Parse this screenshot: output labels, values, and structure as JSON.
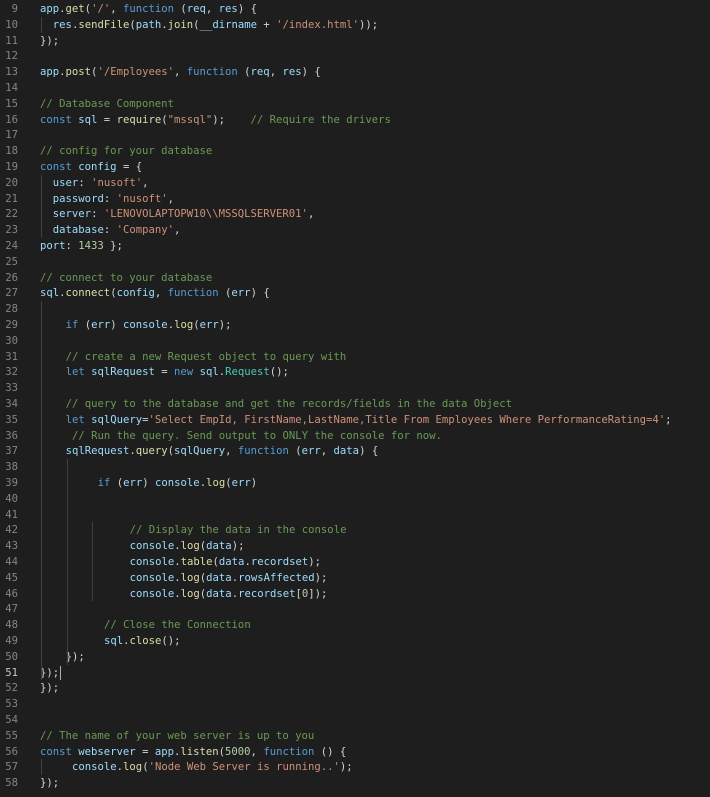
{
  "editor": {
    "active_line": 51,
    "lines": [
      {
        "n": 9,
        "indent": 0,
        "tokens": [
          [
            "v",
            "app"
          ],
          [
            "p",
            "."
          ],
          [
            "f",
            "get"
          ],
          [
            "p",
            "("
          ],
          [
            "s",
            "'/'"
          ],
          [
            "p",
            ", "
          ],
          [
            "k",
            "function"
          ],
          [
            "p",
            " ("
          ],
          [
            "v",
            "req"
          ],
          [
            "p",
            ", "
          ],
          [
            "v",
            "res"
          ],
          [
            "p",
            ") {"
          ]
        ]
      },
      {
        "n": 10,
        "indent": 2,
        "tokens": [
          [
            "v",
            "res"
          ],
          [
            "p",
            "."
          ],
          [
            "f",
            "sendFile"
          ],
          [
            "p",
            "("
          ],
          [
            "v",
            "path"
          ],
          [
            "p",
            "."
          ],
          [
            "f",
            "join"
          ],
          [
            "p",
            "("
          ],
          [
            "v",
            "__dirname"
          ],
          [
            "p",
            " + "
          ],
          [
            "s",
            "'/index.html'"
          ],
          [
            "p",
            "));"
          ]
        ]
      },
      {
        "n": 11,
        "indent": 0,
        "tokens": [
          [
            "p",
            "});"
          ]
        ]
      },
      {
        "n": 12,
        "indent": 0,
        "tokens": []
      },
      {
        "n": 13,
        "indent": 0,
        "tokens": [
          [
            "v",
            "app"
          ],
          [
            "p",
            "."
          ],
          [
            "f",
            "post"
          ],
          [
            "p",
            "("
          ],
          [
            "s",
            "'/Employees'"
          ],
          [
            "p",
            ", "
          ],
          [
            "k",
            "function"
          ],
          [
            "p",
            " ("
          ],
          [
            "v",
            "req"
          ],
          [
            "p",
            ", "
          ],
          [
            "v",
            "res"
          ],
          [
            "p",
            ") {"
          ]
        ]
      },
      {
        "n": 14,
        "indent": 0,
        "tokens": []
      },
      {
        "n": 15,
        "indent": 0,
        "tokens": [
          [
            "c",
            "// Database Component"
          ]
        ]
      },
      {
        "n": 16,
        "indent": 0,
        "tokens": [
          [
            "k",
            "const"
          ],
          [
            "p",
            " "
          ],
          [
            "v",
            "sql"
          ],
          [
            "p",
            " = "
          ],
          [
            "f",
            "require"
          ],
          [
            "p",
            "("
          ],
          [
            "s",
            "\"mssql\""
          ],
          [
            "p",
            ");    "
          ],
          [
            "c",
            "// Require the drivers"
          ]
        ]
      },
      {
        "n": 17,
        "indent": 0,
        "tokens": []
      },
      {
        "n": 18,
        "indent": 0,
        "tokens": [
          [
            "c",
            "// config for your database"
          ]
        ]
      },
      {
        "n": 19,
        "indent": 0,
        "tokens": [
          [
            "k",
            "const"
          ],
          [
            "p",
            " "
          ],
          [
            "v",
            "config"
          ],
          [
            "p",
            " = {"
          ]
        ]
      },
      {
        "n": 20,
        "indent": 2,
        "tokens": [
          [
            "v",
            "user"
          ],
          [
            "p",
            ": "
          ],
          [
            "s",
            "'nusoft'"
          ],
          [
            "p",
            ","
          ]
        ]
      },
      {
        "n": 21,
        "indent": 2,
        "tokens": [
          [
            "v",
            "password"
          ],
          [
            "p",
            ": "
          ],
          [
            "s",
            "'nusoft'"
          ],
          [
            "p",
            ","
          ]
        ]
      },
      {
        "n": 22,
        "indent": 2,
        "tokens": [
          [
            "v",
            "server"
          ],
          [
            "p",
            ": "
          ],
          [
            "s",
            "'LENOVOLAPTOPW10\\\\MSSQLSERVER01'"
          ],
          [
            "p",
            ","
          ]
        ]
      },
      {
        "n": 23,
        "indent": 2,
        "tokens": [
          [
            "v",
            "database"
          ],
          [
            "p",
            ": "
          ],
          [
            "s",
            "'Company'"
          ],
          [
            "p",
            ","
          ]
        ]
      },
      {
        "n": 24,
        "indent": 0,
        "tokens": [
          [
            "v",
            "port"
          ],
          [
            "p",
            ": "
          ],
          [
            "n",
            "1433"
          ],
          [
            "p",
            " };"
          ]
        ]
      },
      {
        "n": 25,
        "indent": 0,
        "tokens": []
      },
      {
        "n": 26,
        "indent": 0,
        "tokens": [
          [
            "c",
            "// connect to your database"
          ]
        ]
      },
      {
        "n": 27,
        "indent": 0,
        "tokens": [
          [
            "v",
            "sql"
          ],
          [
            "p",
            "."
          ],
          [
            "f",
            "connect"
          ],
          [
            "p",
            "("
          ],
          [
            "v",
            "config"
          ],
          [
            "p",
            ", "
          ],
          [
            "k",
            "function"
          ],
          [
            "p",
            " ("
          ],
          [
            "v",
            "err"
          ],
          [
            "p",
            ") {"
          ]
        ]
      },
      {
        "n": 28,
        "indent": 0,
        "tokens": []
      },
      {
        "n": 29,
        "indent": 4,
        "tokens": [
          [
            "k",
            "if"
          ],
          [
            "p",
            " ("
          ],
          [
            "v",
            "err"
          ],
          [
            "p",
            ") "
          ],
          [
            "v",
            "console"
          ],
          [
            "p",
            "."
          ],
          [
            "f",
            "log"
          ],
          [
            "p",
            "("
          ],
          [
            "v",
            "err"
          ],
          [
            "p",
            ");"
          ]
        ]
      },
      {
        "n": 30,
        "indent": 0,
        "tokens": []
      },
      {
        "n": 31,
        "indent": 4,
        "tokens": [
          [
            "c",
            "// create a new Request object to query with"
          ]
        ]
      },
      {
        "n": 32,
        "indent": 4,
        "tokens": [
          [
            "k",
            "let"
          ],
          [
            "p",
            " "
          ],
          [
            "v",
            "sqlRequest"
          ],
          [
            "p",
            " = "
          ],
          [
            "k",
            "new"
          ],
          [
            "p",
            " "
          ],
          [
            "v",
            "sql"
          ],
          [
            "p",
            "."
          ],
          [
            "t",
            "Request"
          ],
          [
            "p",
            "();"
          ]
        ]
      },
      {
        "n": 33,
        "indent": 0,
        "tokens": []
      },
      {
        "n": 34,
        "indent": 4,
        "tokens": [
          [
            "c",
            "// query to the database and get the records/fields in the data Object"
          ]
        ]
      },
      {
        "n": 35,
        "indent": 4,
        "tokens": [
          [
            "k",
            "let"
          ],
          [
            "p",
            " "
          ],
          [
            "v",
            "sqlQuery"
          ],
          [
            "p",
            "="
          ],
          [
            "s",
            "'Select EmpId, FirstName,LastName,Title From Employees Where PerformanceRating=4'"
          ],
          [
            "p",
            ";"
          ]
        ]
      },
      {
        "n": 36,
        "indent": 5,
        "tokens": [
          [
            "c",
            "// Run the query. Send output to ONLY the console for now."
          ]
        ]
      },
      {
        "n": 37,
        "indent": 4,
        "tokens": [
          [
            "v",
            "sqlRequest"
          ],
          [
            "p",
            "."
          ],
          [
            "f",
            "query"
          ],
          [
            "p",
            "("
          ],
          [
            "v",
            "sqlQuery"
          ],
          [
            "p",
            ", "
          ],
          [
            "k",
            "function"
          ],
          [
            "p",
            " ("
          ],
          [
            "v",
            "err"
          ],
          [
            "p",
            ", "
          ],
          [
            "v",
            "data"
          ],
          [
            "p",
            ") {"
          ]
        ]
      },
      {
        "n": 38,
        "indent": 0,
        "tokens": []
      },
      {
        "n": 39,
        "indent": 9,
        "tokens": [
          [
            "k",
            "if"
          ],
          [
            "p",
            " ("
          ],
          [
            "v",
            "err"
          ],
          [
            "p",
            ") "
          ],
          [
            "v",
            "console"
          ],
          [
            "p",
            "."
          ],
          [
            "f",
            "log"
          ],
          [
            "p",
            "("
          ],
          [
            "v",
            "err"
          ],
          [
            "p",
            ")"
          ]
        ]
      },
      {
        "n": 40,
        "indent": 0,
        "tokens": []
      },
      {
        "n": 41,
        "indent": 0,
        "tokens": []
      },
      {
        "n": 42,
        "indent": 14,
        "tokens": [
          [
            "c",
            "// Display the data in the console"
          ]
        ]
      },
      {
        "n": 43,
        "indent": 14,
        "tokens": [
          [
            "v",
            "console"
          ],
          [
            "p",
            "."
          ],
          [
            "f",
            "log"
          ],
          [
            "p",
            "("
          ],
          [
            "v",
            "data"
          ],
          [
            "p",
            ");"
          ]
        ]
      },
      {
        "n": 44,
        "indent": 14,
        "tokens": [
          [
            "v",
            "console"
          ],
          [
            "p",
            "."
          ],
          [
            "f",
            "table"
          ],
          [
            "p",
            "("
          ],
          [
            "v",
            "data"
          ],
          [
            "p",
            "."
          ],
          [
            "v",
            "recordset"
          ],
          [
            "p",
            ");"
          ]
        ]
      },
      {
        "n": 45,
        "indent": 14,
        "tokens": [
          [
            "v",
            "console"
          ],
          [
            "p",
            "."
          ],
          [
            "f",
            "log"
          ],
          [
            "p",
            "("
          ],
          [
            "v",
            "data"
          ],
          [
            "p",
            "."
          ],
          [
            "v",
            "rowsAffected"
          ],
          [
            "p",
            ");"
          ]
        ]
      },
      {
        "n": 46,
        "indent": 14,
        "tokens": [
          [
            "v",
            "console"
          ],
          [
            "p",
            "."
          ],
          [
            "f",
            "log"
          ],
          [
            "p",
            "("
          ],
          [
            "v",
            "data"
          ],
          [
            "p",
            "."
          ],
          [
            "v",
            "recordset"
          ],
          [
            "p",
            "["
          ],
          [
            "n",
            "0"
          ],
          [
            "p",
            "]);"
          ]
        ]
      },
      {
        "n": 47,
        "indent": 0,
        "tokens": []
      },
      {
        "n": 48,
        "indent": 10,
        "tokens": [
          [
            "c",
            "// Close the Connection"
          ]
        ]
      },
      {
        "n": 49,
        "indent": 10,
        "tokens": [
          [
            "v",
            "sql"
          ],
          [
            "p",
            "."
          ],
          [
            "f",
            "close"
          ],
          [
            "p",
            "();"
          ]
        ]
      },
      {
        "n": 50,
        "indent": 4,
        "tokens": [
          [
            "p",
            "});"
          ]
        ]
      },
      {
        "n": 51,
        "indent": 0,
        "tokens": [
          [
            "p",
            "});"
          ]
        ]
      },
      {
        "n": 52,
        "indent": 0,
        "tokens": [
          [
            "p",
            "});"
          ]
        ]
      },
      {
        "n": 53,
        "indent": 0,
        "tokens": []
      },
      {
        "n": 54,
        "indent": 0,
        "tokens": []
      },
      {
        "n": 55,
        "indent": 0,
        "tokens": [
          [
            "c",
            "// The name of your web server is up to you"
          ]
        ]
      },
      {
        "n": 56,
        "indent": 0,
        "tokens": [
          [
            "k",
            "const"
          ],
          [
            "p",
            " "
          ],
          [
            "v",
            "webserver"
          ],
          [
            "p",
            " = "
          ],
          [
            "v",
            "app"
          ],
          [
            "p",
            "."
          ],
          [
            "f",
            "listen"
          ],
          [
            "p",
            "("
          ],
          [
            "n",
            "5000"
          ],
          [
            "p",
            ", "
          ],
          [
            "k",
            "function"
          ],
          [
            "p",
            " () {"
          ]
        ]
      },
      {
        "n": 57,
        "indent": 5,
        "tokens": [
          [
            "v",
            "console"
          ],
          [
            "p",
            "."
          ],
          [
            "f",
            "log"
          ],
          [
            "p",
            "("
          ],
          [
            "s",
            "'Node Web Server is running..'"
          ],
          [
            "p",
            ");"
          ]
        ]
      },
      {
        "n": 58,
        "indent": 0,
        "tokens": [
          [
            "p",
            "});"
          ]
        ]
      }
    ]
  }
}
